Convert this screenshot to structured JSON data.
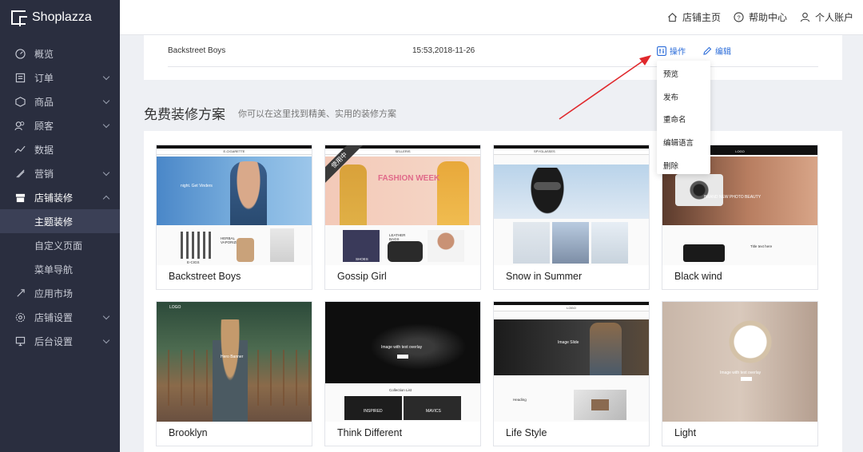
{
  "app": {
    "name": "Shoplazza"
  },
  "topbar": {
    "shop_home": "店铺主页",
    "help": "帮助中心",
    "account": "个人账户"
  },
  "sidebar": {
    "items": [
      {
        "label": "概览",
        "icon": "dashboard-icon",
        "has_children": false
      },
      {
        "label": "订单",
        "icon": "order-icon",
        "has_children": true
      },
      {
        "label": "商品",
        "icon": "product-icon",
        "has_children": true
      },
      {
        "label": "顾客",
        "icon": "customer-icon",
        "has_children": true
      },
      {
        "label": "数据",
        "icon": "data-icon",
        "has_children": false
      },
      {
        "label": "营销",
        "icon": "marketing-icon",
        "has_children": true
      },
      {
        "label": "店铺装修",
        "icon": "store-design-icon",
        "has_children": true,
        "open": true
      },
      {
        "label": "应用市场",
        "icon": "app-market-icon",
        "has_children": false
      },
      {
        "label": "店铺设置",
        "icon": "store-settings-icon",
        "has_children": true
      },
      {
        "label": "后台设置",
        "icon": "admin-settings-icon",
        "has_children": true
      }
    ],
    "sub_items": [
      "主题装修",
      "自定义页面",
      "菜单导航"
    ]
  },
  "current_theme": {
    "name": "Backstreet Boys",
    "time": "15:53,2018-11-26",
    "action_label": "操作",
    "edit_label": "编辑"
  },
  "dropdown": {
    "items": [
      "预览",
      "发布",
      "重命名",
      "编辑语言",
      "删除"
    ]
  },
  "section": {
    "title": "免费装修方案",
    "subtitle": "你可以在这里找到精美、实用的装修方案"
  },
  "themes": [
    {
      "name": "Backstreet Boys",
      "brand": "E-CIGARETTE",
      "hero_text": "night. Get Vinders",
      "p1": "E-CIGS",
      "p2": "HERBAL VAPORIZERS"
    },
    {
      "name": "Gossip Girl",
      "brand": "SELLERIS",
      "hero_text": "FASHION WEEK",
      "ribbon": "使用中",
      "p1": "SHOES",
      "p2": "LEATHER BAGS"
    },
    {
      "name": "Snow in Summer",
      "brand": "SPYGLASSES"
    },
    {
      "name": "Black wind",
      "brand": "LOGO",
      "hero_text": "BRAND NEW PHOTO BEAUTY",
      "p1": "Title text here"
    },
    {
      "name": "Brooklyn",
      "brand": "LOGO",
      "hero_text": "Hero Banner"
    },
    {
      "name": "Think Different",
      "hero_text": "Image with text overlay",
      "p1": "Collection List",
      "p2": "INSPIRED",
      "p3": "MAVICS"
    },
    {
      "name": "Life Style",
      "brand": "LOGO",
      "hero_text": "Image Slide",
      "p1": "Heading"
    },
    {
      "name": "Light",
      "hero_text": "Image with text overlay"
    }
  ],
  "colors": {
    "sidebar_bg": "#2a2e3f",
    "accent": "#2b6cd9",
    "arrow": "#e0282c"
  }
}
